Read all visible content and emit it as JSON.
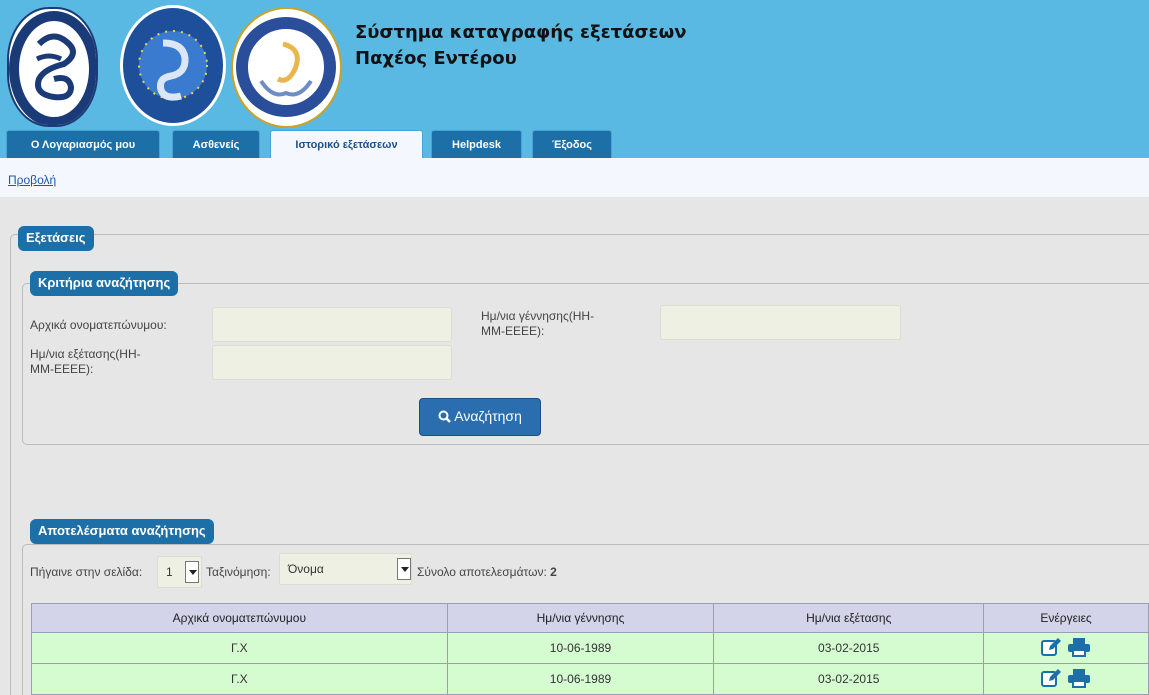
{
  "header": {
    "title_line1": "Σύστημα καταγραφής εξετάσεων",
    "title_line2": "Παχέος Εντέρου"
  },
  "tabs": [
    {
      "label": "Ο Λογαριασμός μου",
      "active": false
    },
    {
      "label": "Ασθενείς",
      "active": false
    },
    {
      "label": "Ιστορικό εξετάσεων",
      "active": true
    },
    {
      "label": "Helpdesk",
      "active": false
    },
    {
      "label": "Έξοδος",
      "active": false
    }
  ],
  "subnav": {
    "link": "Προβολή"
  },
  "section": {
    "legend": "Εξετάσεις"
  },
  "search": {
    "legend": "Κριτήρια αναζήτησης",
    "initials_label": "Αρχικά ονοματεπώνυμου:",
    "initials_value": "",
    "birthdate_label_1": "Ημ/νια γέννησης(ΗΗ-",
    "birthdate_label_2": "ΜΜ-ΕΕΕΕ):",
    "birthdate_value": "",
    "examdate_label_1": "Ημ/νια εξέτασης(ΗΗ-",
    "examdate_label_2": "ΜΜ-ΕΕΕΕ):",
    "examdate_value": "",
    "button_label": "Αναζήτηση",
    "button_icon": "search-icon"
  },
  "results": {
    "legend": "Αποτελέσματα αναζήτησης",
    "goto_page_label": "Πήγαινε στην σελίδα:",
    "page_value": "1",
    "sort_label": "Ταξινόμηση:",
    "sort_value": "Όνομα",
    "total_label": "Σύνολο αποτελεσμάτων:",
    "total_value": "2",
    "columns": [
      "Αρχικά ονοματεπώνυμου",
      "Ημ/νια γέννησης",
      "Ημ/νια εξέτασης",
      "Ενέργειες"
    ],
    "rows": [
      {
        "initials": "Γ.Χ",
        "birthdate": "10-06-1989",
        "examdate": "03-02-2015",
        "actions": [
          "edit-icon",
          "print-icon"
        ]
      },
      {
        "initials": "Γ.Χ",
        "birthdate": "10-06-1989",
        "examdate": "03-02-2015",
        "actions": [
          "edit-icon",
          "print-icon"
        ]
      }
    ]
  },
  "colors": {
    "header_bg": "#5ab9e3",
    "tab_bg": "#1d6fa8",
    "legend_bg": "#1d6fa8",
    "button_bg": "#2a6eb0",
    "row_bg": "#d5fcd0",
    "table_header_bg": "#d3d3e9",
    "link": "#1c56b0"
  }
}
